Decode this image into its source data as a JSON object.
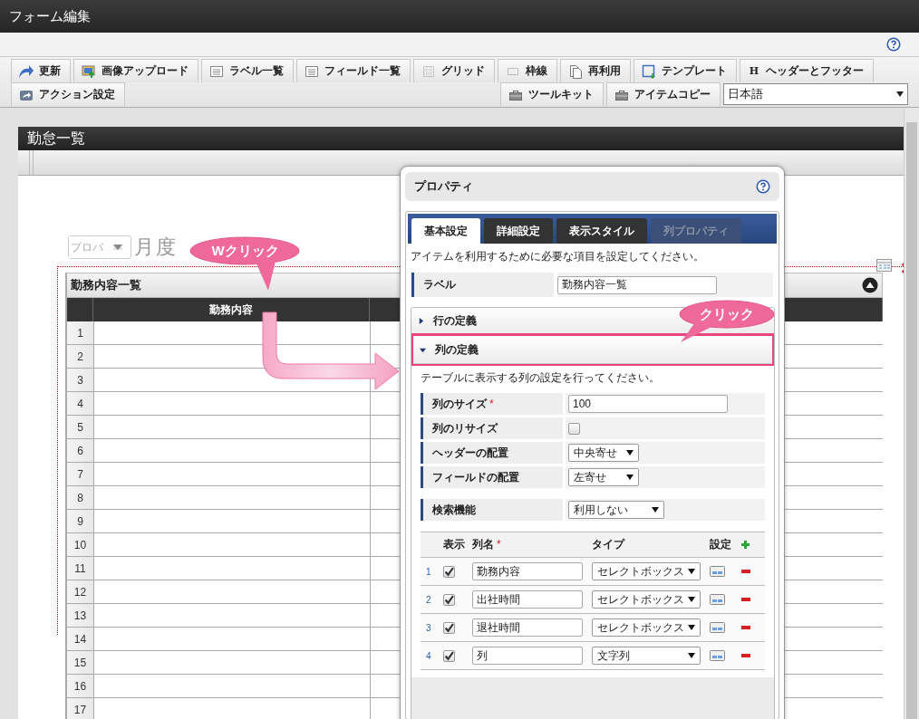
{
  "window": {
    "title": "フォーム編集"
  },
  "toolbar": {
    "main": [
      {
        "label": "更新"
      },
      {
        "label": "画像アップロード"
      },
      {
        "label": "ラベル一覧"
      },
      {
        "label": "フィールド一覧"
      },
      {
        "label": "グリッド"
      },
      {
        "label": "枠線"
      },
      {
        "label": "再利用"
      },
      {
        "label": "テンプレート"
      },
      {
        "label": "ヘッダーとフッター",
        "glyph": "H"
      }
    ],
    "second_left": [
      {
        "label": "アクション設定"
      }
    ],
    "second_right": [
      {
        "label": "ツールキット"
      },
      {
        "label": "アイテムコピー"
      }
    ],
    "language": {
      "value": "日本語"
    }
  },
  "form": {
    "title": "勤怠一覧",
    "month_field": {
      "value": "プロパ"
    },
    "heading": "月度",
    "table": {
      "title": "勤務内容一覧",
      "columns": [
        "勤務内容"
      ],
      "row_numbers": [
        "1",
        "2",
        "3",
        "4",
        "5",
        "6",
        "7",
        "8",
        "9",
        "10",
        "11",
        "12",
        "13",
        "14",
        "15",
        "16",
        "17"
      ]
    }
  },
  "properties": {
    "title": "プロパティ",
    "tabs": [
      {
        "label": "基本設定",
        "selected": true,
        "disabled": false
      },
      {
        "label": "詳細設定",
        "selected": false,
        "disabled": false
      },
      {
        "label": "表示スタイル",
        "selected": false,
        "disabled": false
      },
      {
        "label": "列プロパティ",
        "selected": false,
        "disabled": true
      }
    ],
    "description": "アイテムを利用するために必要な項目を設定してください。",
    "label_field": {
      "label": "ラベル",
      "value": "勤務内容一覧"
    },
    "sections": [
      {
        "title": "行の定義",
        "expanded": false,
        "highlighted": false
      },
      {
        "title": "列の定義",
        "expanded": true,
        "highlighted": true,
        "description": "テーブルに表示する列の設定を行ってください。",
        "settings": [
          {
            "kind": "text",
            "label": "列のサイズ",
            "required_mark": "*",
            "value": "100"
          },
          {
            "kind": "checkbox",
            "label": "列のリサイズ",
            "checked": false
          },
          {
            "kind": "select",
            "label": "ヘッダーの配置",
            "value": "中央寄せ"
          },
          {
            "kind": "select",
            "label": "フィールドの配置",
            "value": "左寄せ"
          }
        ],
        "search_setting": {
          "kind": "select",
          "label": "検索機能",
          "value": "利用しない"
        },
        "columns_table": {
          "headers": {
            "visible": "表示",
            "name": "列名",
            "name_required_mark": "*",
            "type": "タイプ",
            "settings": "設定"
          },
          "rows": [
            {
              "number": "1",
              "visible": true,
              "name": "勤務内容",
              "type": "セレクトボックス"
            },
            {
              "number": "2",
              "visible": true,
              "name": "出社時間",
              "type": "セレクトボックス"
            },
            {
              "number": "3",
              "visible": true,
              "name": "退社時間",
              "type": "セレクトボックス"
            },
            {
              "number": "4",
              "visible": true,
              "name": "列",
              "type": "文字列"
            }
          ]
        }
      }
    ]
  },
  "annotations": [
    {
      "text": "Wクリック"
    },
    {
      "text": "クリック"
    }
  ]
}
